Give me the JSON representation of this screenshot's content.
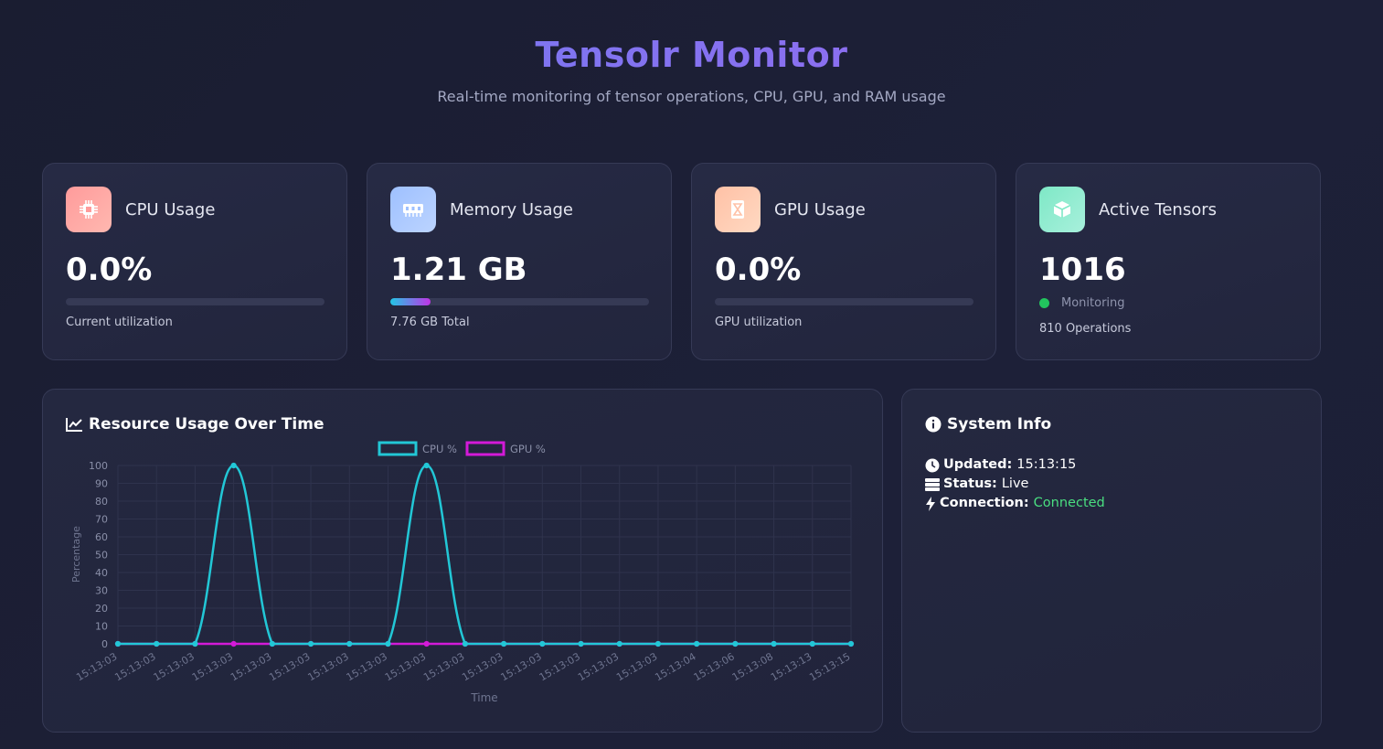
{
  "header": {
    "title": "Tensolr Monitor",
    "subtitle": "Real-time monitoring of tensor operations, CPU, GPU, and RAM usage"
  },
  "cards": {
    "cpu": {
      "title": "CPU Usage",
      "value": "0.0%",
      "sub": "Current utilization",
      "icon": "cpu-chip-icon",
      "fill": 0.0
    },
    "memory": {
      "title": "Memory Usage",
      "value": "1.21 GB",
      "sub": "7.76 GB Total",
      "icon": "memory-icon",
      "fill": 0.156
    },
    "gpu": {
      "title": "GPU Usage",
      "value": "0.0%",
      "sub": "GPU utilization",
      "icon": "gpu-icon",
      "fill": 0.0
    },
    "tensors": {
      "title": "Active Tensors",
      "value": "1016",
      "status": "Monitoring",
      "ops": "810 Operations",
      "icon": "cube-icon"
    }
  },
  "chart_panel": {
    "title": "Resource Usage Over Time"
  },
  "info_panel": {
    "title": "System Info",
    "updated_label": "Updated:",
    "updated_value": "15:13:15",
    "status_label": "Status:",
    "status_value": "Live",
    "connection_label": "Connection:",
    "connection_value": "Connected"
  },
  "colors": {
    "cpu_line": "#22c7d6",
    "gpu_line": "#d31ad8",
    "connected": "#4ade80",
    "accent": "#7c6ff0"
  },
  "chart_data": {
    "type": "line",
    "xlabel": "Time",
    "ylabel": "Percentage",
    "ylim": [
      0,
      100
    ],
    "yticks": [
      0,
      10,
      20,
      30,
      40,
      50,
      60,
      70,
      80,
      90,
      100
    ],
    "legend_position": "top-center",
    "grid": true,
    "x": [
      "15:13:03",
      "15:13:03",
      "15:13:03",
      "15:13:03",
      "15:13:03",
      "15:13:03",
      "15:13:03",
      "15:13:03",
      "15:13:03",
      "15:13:03",
      "15:13:03",
      "15:13:03",
      "15:13:03",
      "15:13:03",
      "15:13:03",
      "15:13:04",
      "15:13:06",
      "15:13:08",
      "15:13:13",
      "15:13:15"
    ],
    "series": [
      {
        "name": "CPU %",
        "values": [
          0,
          0,
          0,
          100,
          0,
          0,
          0,
          0,
          100,
          0,
          0,
          0,
          0,
          0,
          0,
          0,
          0,
          0,
          0,
          0
        ]
      },
      {
        "name": "GPU %",
        "values": [
          0,
          0,
          0,
          0,
          0,
          0,
          0,
          0,
          0,
          0,
          0,
          0,
          0,
          0,
          0,
          0,
          0,
          0,
          0,
          0
        ]
      }
    ]
  }
}
